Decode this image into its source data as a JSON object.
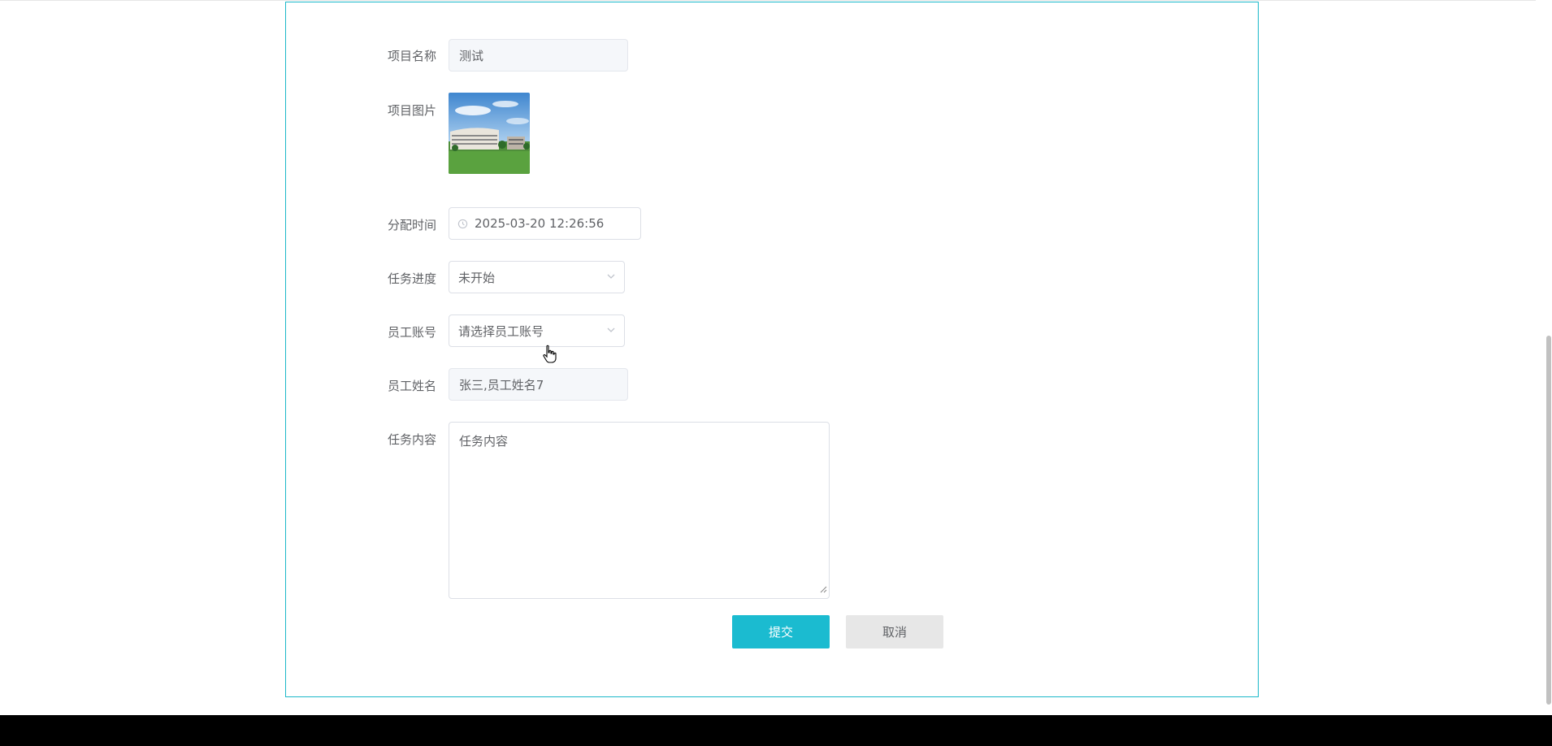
{
  "form": {
    "project_name": {
      "label": "项目名称",
      "value": "测试"
    },
    "project_image": {
      "label": "项目图片"
    },
    "assign_time": {
      "label": "分配时间",
      "value": "2025-03-20 12:26:56",
      "icon": "clock-icon"
    },
    "task_progress": {
      "label": "任务进度",
      "value": "未开始",
      "icon": "chevron-down-icon"
    },
    "employee_account": {
      "label": "员工账号",
      "placeholder": "请选择员工账号",
      "icon": "chevron-down-icon"
    },
    "employee_name": {
      "label": "员工姓名",
      "value": "张三,员工姓名7"
    },
    "task_content": {
      "label": "任务内容",
      "placeholder": "任务内容"
    }
  },
  "buttons": {
    "submit": "提交",
    "cancel": "取消"
  },
  "colors": {
    "accent": "#1bbbd0",
    "border": "#1cb8c9",
    "cancel_bg": "#e7e7e7"
  }
}
